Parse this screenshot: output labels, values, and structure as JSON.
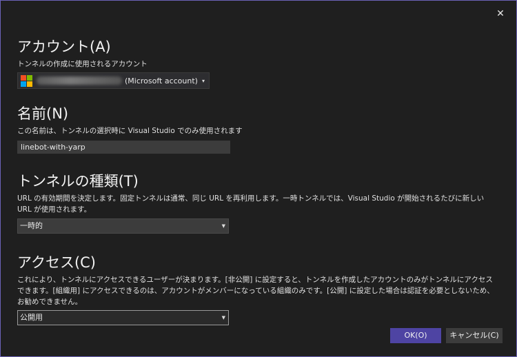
{
  "dialog": {
    "close_glyph": "✕"
  },
  "account": {
    "heading": "アカウント(A)",
    "description": "トンネルの作成に使用されるアカウント",
    "suffix": "(Microsoft account)",
    "caret": "▾",
    "logo_colors": [
      "#f25022",
      "#7fba00",
      "#00a4ef",
      "#ffb900"
    ]
  },
  "name": {
    "heading": "名前(N)",
    "description": "この名前は、トンネルの選択時に Visual Studio でのみ使用されます",
    "value": "linebot-with-yarp"
  },
  "tunnel_type": {
    "heading": "トンネルの種類(T)",
    "description": "URL の有効期間を決定します。固定トンネルは通常、同じ URL を再利用します。一時トンネルでは、Visual Studio が開始されるたびに新しい URL が使用されます。",
    "selected": "一時的",
    "arrow": "▼"
  },
  "access": {
    "heading": "アクセス(C)",
    "description": "これにより、トンネルにアクセスできるユーザーが決まります。[非公開] に設定すると、トンネルを作成したアカウントのみがトンネルにアクセスできます。[組織用] にアクセスできるのは、アカウントがメンバーになっている組織のみです。[公開] に設定した場合は認証を必要としないため、お勧めできません。",
    "selected": "公開用",
    "arrow": "▼"
  },
  "buttons": {
    "ok": "OK(O)",
    "cancel": "キャンセル(C)"
  }
}
